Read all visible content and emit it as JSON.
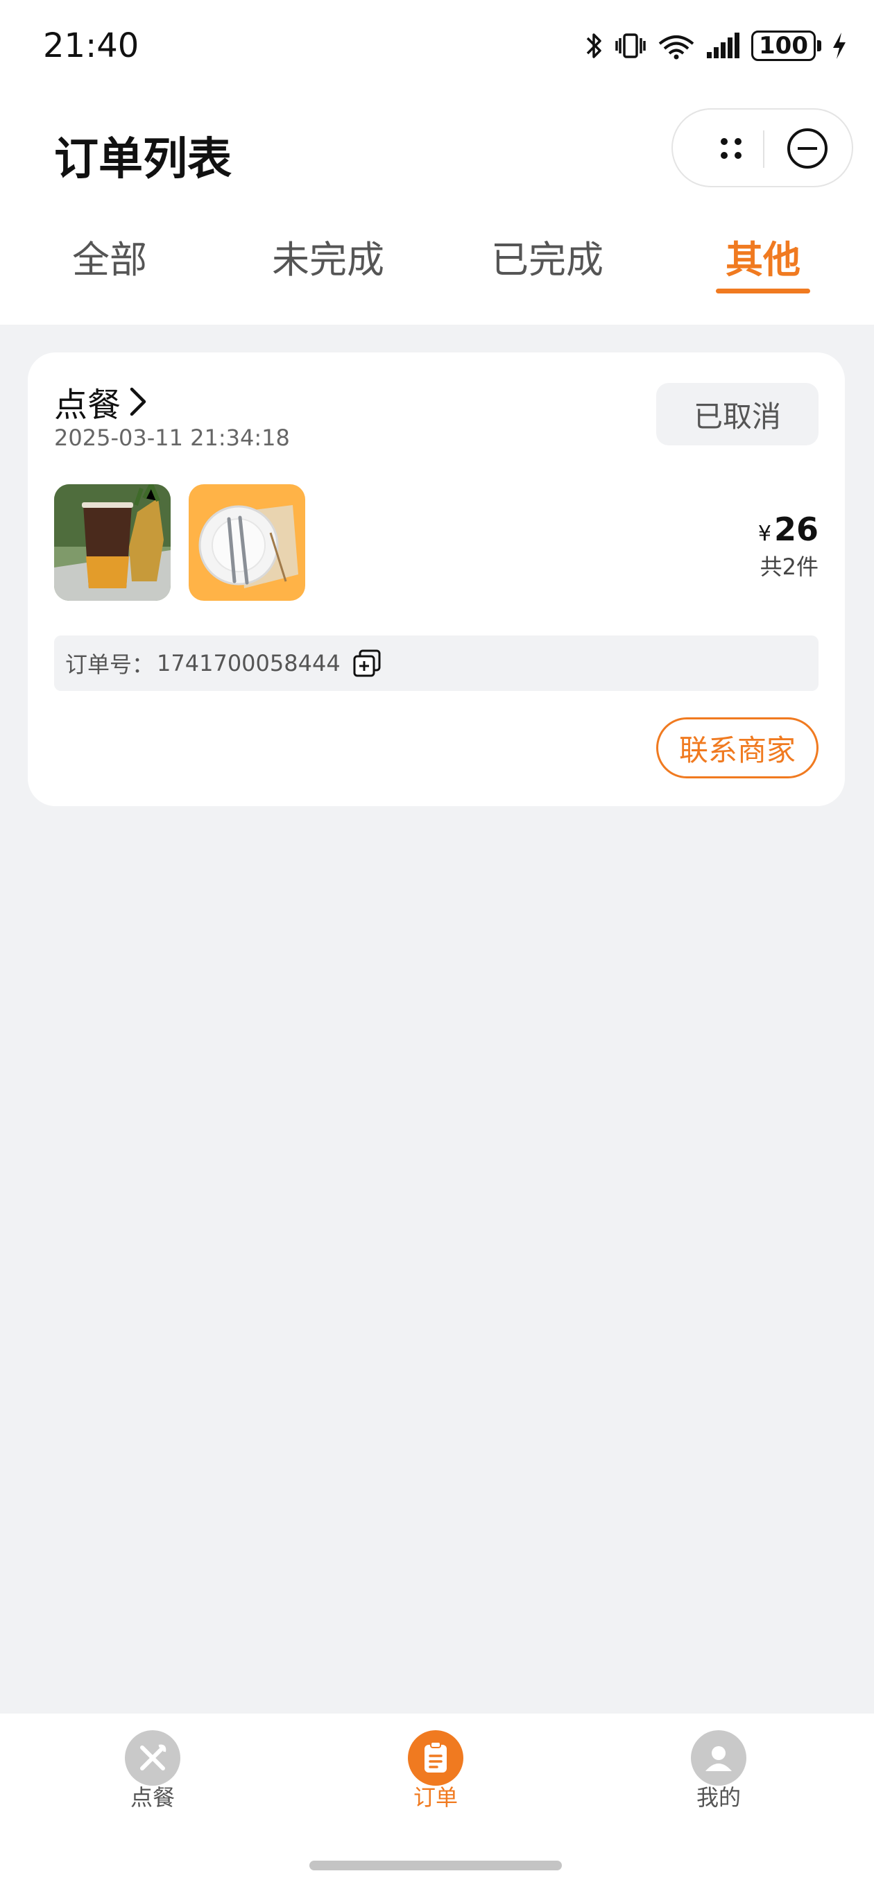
{
  "status_bar": {
    "time": "21:40",
    "battery": "100"
  },
  "header": {
    "title": "订单列表"
  },
  "tabs": [
    {
      "label": "全部",
      "active": false
    },
    {
      "label": "未完成",
      "active": false
    },
    {
      "label": "已完成",
      "active": false
    },
    {
      "label": "其他",
      "active": true
    }
  ],
  "order": {
    "shop_name": "点餐",
    "time": "2025-03-11 21:34:18",
    "status": "已取消",
    "currency": "¥",
    "price": "26",
    "count": "共2件",
    "order_no_label": "订单号：",
    "order_no": "1741700058444",
    "contact_label": "联系商家",
    "images": [
      "iced-coffee-pineapple-photo",
      "plate-cutlery-photo"
    ]
  },
  "tabbar": [
    {
      "label": "点餐",
      "icon": "utensils-icon",
      "active": false
    },
    {
      "label": "订单",
      "icon": "order-list-icon",
      "active": true
    },
    {
      "label": "我的",
      "icon": "user-icon",
      "active": false
    }
  ],
  "colors": {
    "accent": "#f07a20",
    "background": "#f1f2f4",
    "inactive_icon": "#c9c9c9"
  }
}
